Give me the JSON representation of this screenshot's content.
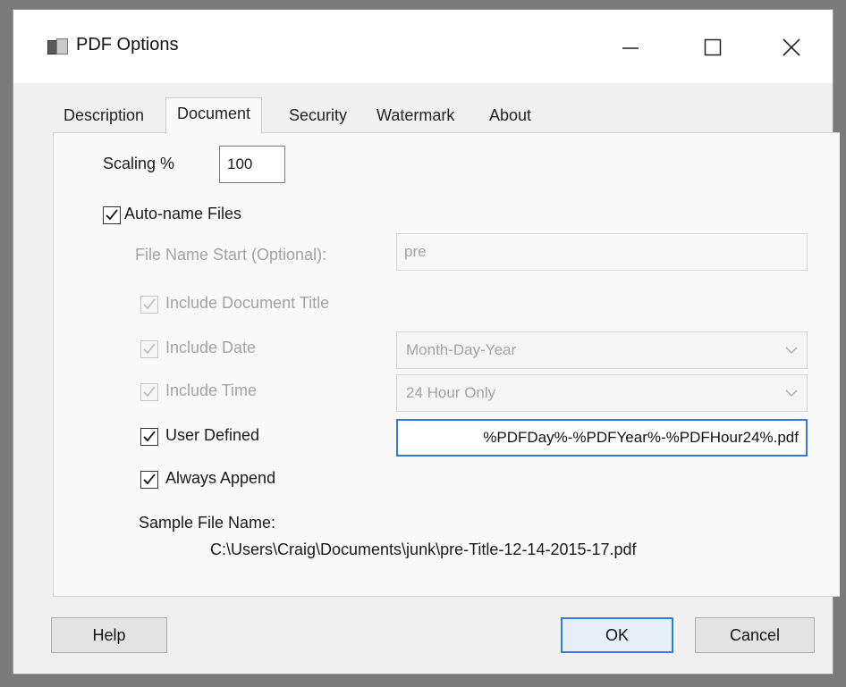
{
  "window": {
    "title": "PDF Options"
  },
  "tabs": [
    {
      "label": "Description"
    },
    {
      "label": "Document"
    },
    {
      "label": "Security"
    },
    {
      "label": "Watermark"
    },
    {
      "label": "About"
    }
  ],
  "active_tab": "Document",
  "scaling": {
    "label": "Scaling %",
    "value": "100"
  },
  "auto_name": {
    "label": "Auto-name Files",
    "checked": true
  },
  "file_name_start": {
    "label": "File Name Start (Optional):",
    "value": "pre"
  },
  "include_title": {
    "label": "Include Document Title",
    "checked": true
  },
  "include_date": {
    "label": "Include Date",
    "checked": true,
    "format": "Month-Day-Year"
  },
  "include_time": {
    "label": "Include Time",
    "checked": true,
    "format": "24 Hour Only"
  },
  "user_defined": {
    "label": "User Defined",
    "checked": true,
    "value": "%PDFDay%-%PDFYear%-%PDFHour24%.pdf"
  },
  "always_append": {
    "label": "Always Append",
    "checked": true
  },
  "sample": {
    "label": "Sample File Name:",
    "path": "C:\\Users\\Craig\\Documents\\junk\\pre-Title-12-14-2015-17.pdf"
  },
  "buttons": {
    "help": "Help",
    "ok": "OK",
    "cancel": "Cancel"
  },
  "colors": {
    "focus": "#3b78d4",
    "disabled_text": "#a3a3a3"
  }
}
